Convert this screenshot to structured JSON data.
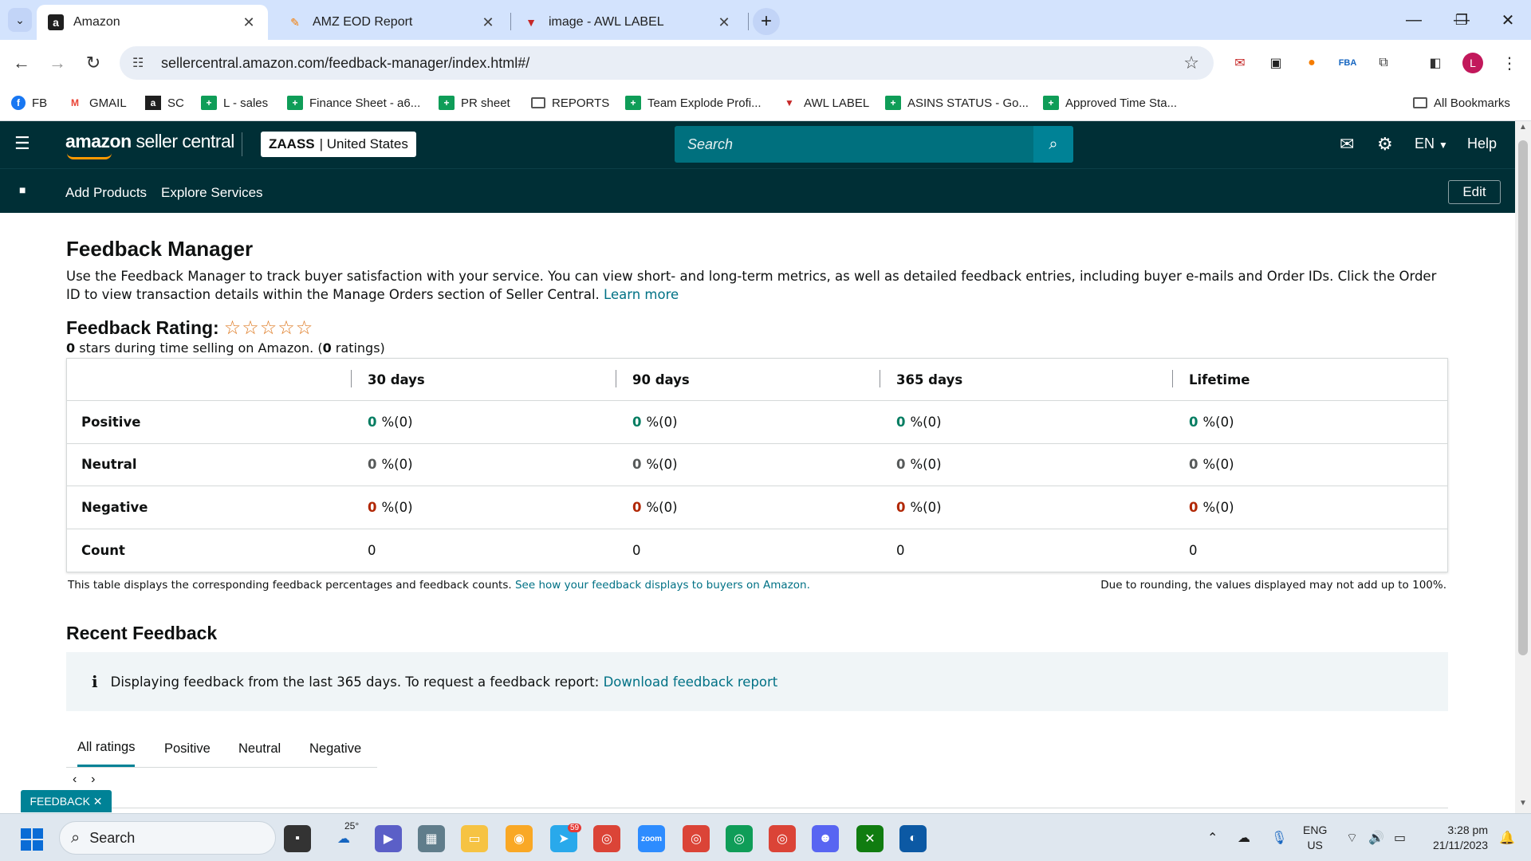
{
  "browser": {
    "tabs": [
      {
        "title": "Amazon",
        "favicon": "amazon-a"
      },
      {
        "title": "AMZ EOD Report",
        "favicon": "pencil"
      },
      {
        "title": "image - AWL LABEL",
        "favicon": "awl-logo"
      }
    ],
    "url": "sellercentral.amazon.com/feedback-manager/index.html#/",
    "profile_initial": "L",
    "bookmarks": [
      "FB",
      "GMAIL",
      "SC",
      "L - sales",
      "Finance Sheet - a6...",
      "PR sheet",
      "REPORTS",
      "Team Explode Profi...",
      "AWL LABEL",
      "ASINS STATUS - Go...",
      "Approved Time Sta..."
    ],
    "all_bookmarks": "All Bookmarks"
  },
  "header": {
    "brand_bold": "amazon",
    "brand_rest": " seller central",
    "store_name": "ZAASS",
    "store_region": "| United States",
    "search_placeholder": "Search",
    "language": "EN",
    "help": "Help"
  },
  "subnav": {
    "links": [
      "Add Products",
      "Explore Services"
    ],
    "edit": "Edit"
  },
  "page": {
    "title": "Feedback Manager",
    "intro": "Use the Feedback Manager to track buyer satisfaction with your service. You can view short- and long-term metrics, as well as detailed feedback entries, including buyer e-mails and Order IDs. Click the Order ID to view transaction details within the Manage Orders section of Seller Central.",
    "learn_more": "Learn more",
    "rating_title": "Feedback Rating:",
    "stars_filled": 0,
    "stars_total": 5,
    "rating_stars": "0",
    "rating_mid": " stars during time selling on Amazon. (",
    "rating_count": "0",
    "rating_end": " ratings)"
  },
  "feedback_table": {
    "columns": [
      "30 days",
      "90 days",
      "365 days",
      "Lifetime"
    ],
    "rows": [
      {
        "label": "Positive",
        "values": [
          "0",
          "0",
          "0",
          "0"
        ],
        "suffix": "%(0)"
      },
      {
        "label": "Neutral",
        "values": [
          "0",
          "0",
          "0",
          "0"
        ],
        "suffix": "%(0)"
      },
      {
        "label": "Negative",
        "values": [
          "0",
          "0",
          "0",
          "0"
        ],
        "suffix": "%(0)"
      },
      {
        "label": "Count",
        "values": [
          "0",
          "0",
          "0",
          "0"
        ]
      }
    ],
    "note": "This table displays the corresponding feedback percentages and feedback counts.",
    "note_link": "See how your feedback displays to buyers on Amazon.",
    "note_right": "Due to rounding, the values displayed may not add up to 100%."
  },
  "recent": {
    "title": "Recent Feedback",
    "info": "Displaying feedback from the last 365 days. To request a feedback report:",
    "info_link": "Download feedback report",
    "tabs": [
      "All ratings",
      "Positive",
      "Neutral",
      "Negative"
    ],
    "active_tab": "All ratings"
  },
  "feedback_button": "FEEDBACK ✕",
  "taskbar": {
    "search": "Search",
    "weather_temp": "25°",
    "telegram_badge": "59",
    "lang_line1": "ENG",
    "lang_line2": "US",
    "time": "3:28 pm",
    "date": "21/11/2023"
  },
  "colors": {
    "header_bg": "#002f36",
    "accent": "#008296",
    "link": "#007185",
    "positive": "#067d62",
    "negative": "#b12704",
    "star": "#de7921"
  }
}
